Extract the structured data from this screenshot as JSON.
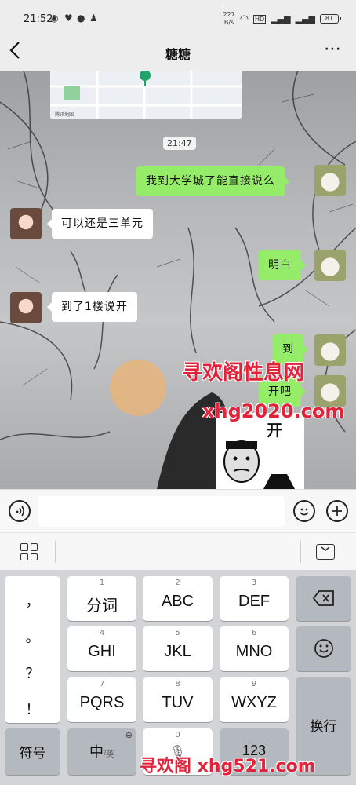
{
  "status_bar": {
    "time": "21:52",
    "network_speed_value": "227",
    "network_speed_unit": "B/s",
    "battery": "81"
  },
  "header": {
    "title": "糖糖"
  },
  "chat": {
    "map_footer": "腾讯地图",
    "timestamp": "21:47",
    "messages": [
      {
        "side": "right",
        "text": "我到大学城了能直接说么"
      },
      {
        "side": "left",
        "text": "可以还是三单元"
      },
      {
        "side": "right",
        "text": "明白"
      },
      {
        "side": "left",
        "text": "到了1楼说开"
      },
      {
        "side": "right",
        "text": "到"
      },
      {
        "side": "right",
        "text": "开吧"
      }
    ],
    "sticker_text": "开"
  },
  "watermarks": {
    "top_cn": "寻欢阁性息网",
    "top_url": "xhg2020.com",
    "bottom": "寻欢阁 xhg521.com"
  },
  "keyboard": {
    "punctuation": [
      "，",
      "。",
      "？",
      "！"
    ],
    "rows": [
      [
        {
          "num": "1",
          "label": "分词"
        },
        {
          "num": "2",
          "label": "ABC"
        },
        {
          "num": "3",
          "label": "DEF"
        }
      ],
      [
        {
          "num": "4",
          "label": "GHI"
        },
        {
          "num": "5",
          "label": "JKL"
        },
        {
          "num": "6",
          "label": "MNO"
        }
      ],
      [
        {
          "num": "7",
          "label": "PQRS"
        },
        {
          "num": "8",
          "label": "TUV"
        },
        {
          "num": "9",
          "label": "WXYZ"
        }
      ]
    ],
    "symbols_label": "符号",
    "lang_label": "中",
    "lang_alt": "/英",
    "space_num": "0",
    "numbers_label": "123",
    "enter_label": "换行"
  }
}
